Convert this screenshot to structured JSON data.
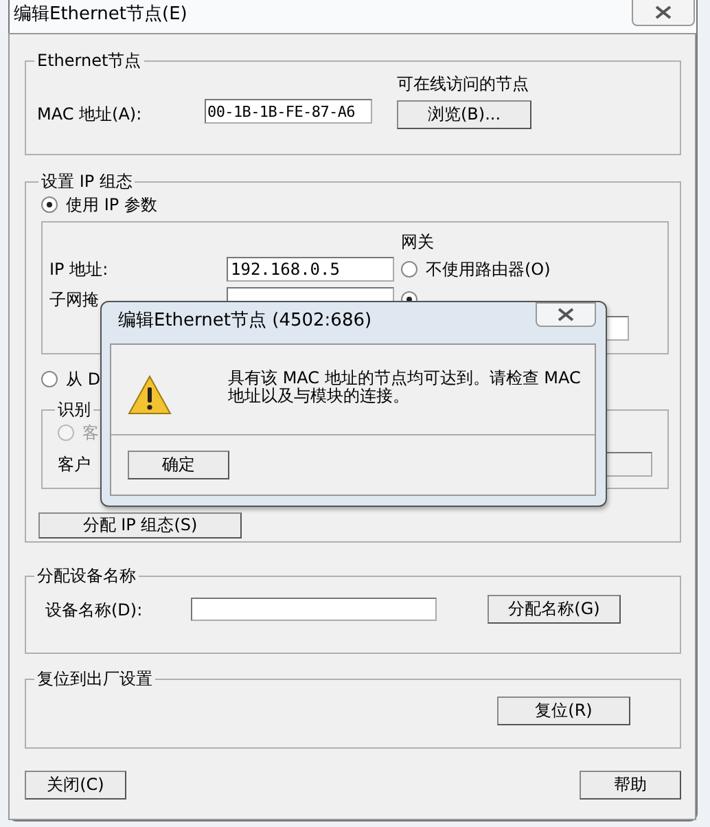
{
  "window": {
    "title": "编辑Ethernet节点(E)"
  },
  "ethernet_node": {
    "legend": "Ethernet节点",
    "mac_label": "MAC 地址(A):",
    "mac_value": "00-1B-1B-FE-87-A6",
    "online_label": "可在线访问的节点",
    "browse_button": "浏览(B)..."
  },
  "ip_config": {
    "legend": "设置 IP 组态",
    "options": [
      {
        "label": "使用 IP 参数",
        "selected": true
      },
      {
        "label": "从 D",
        "selected": false
      }
    ],
    "ip_label": "IP 地址:",
    "ip_value": "192.168.0.5",
    "subnet_label": "子网掩",
    "gateway": {
      "legend": "网关",
      "options": [
        {
          "label": "不使用路由器(O)",
          "selected": false
        },
        {
          "selected": true
        }
      ]
    },
    "identification": {
      "legend": "识别",
      "options": [
        {
          "label": "客",
          "selected": false,
          "disabled": true
        }
      ],
      "client_label": "客户"
    },
    "assign_button": "分配 IP 组态(S)"
  },
  "device_name": {
    "legend": "分配设备名称",
    "label": "设备名称(D):",
    "assign_button": "分配名称(G)"
  },
  "factory_reset": {
    "legend": "复位到出厂设置",
    "reset_button": "复位(R)"
  },
  "buttons": [
    "关闭(C)",
    "帮助"
  ],
  "message_box": {
    "title": "编辑Ethernet节点 (4502:686)",
    "message": "具有该 MAC 地址的节点均可达到。请检查 MAC 地址以及与模块的连接。",
    "buttons": [
      "确定"
    ]
  }
}
